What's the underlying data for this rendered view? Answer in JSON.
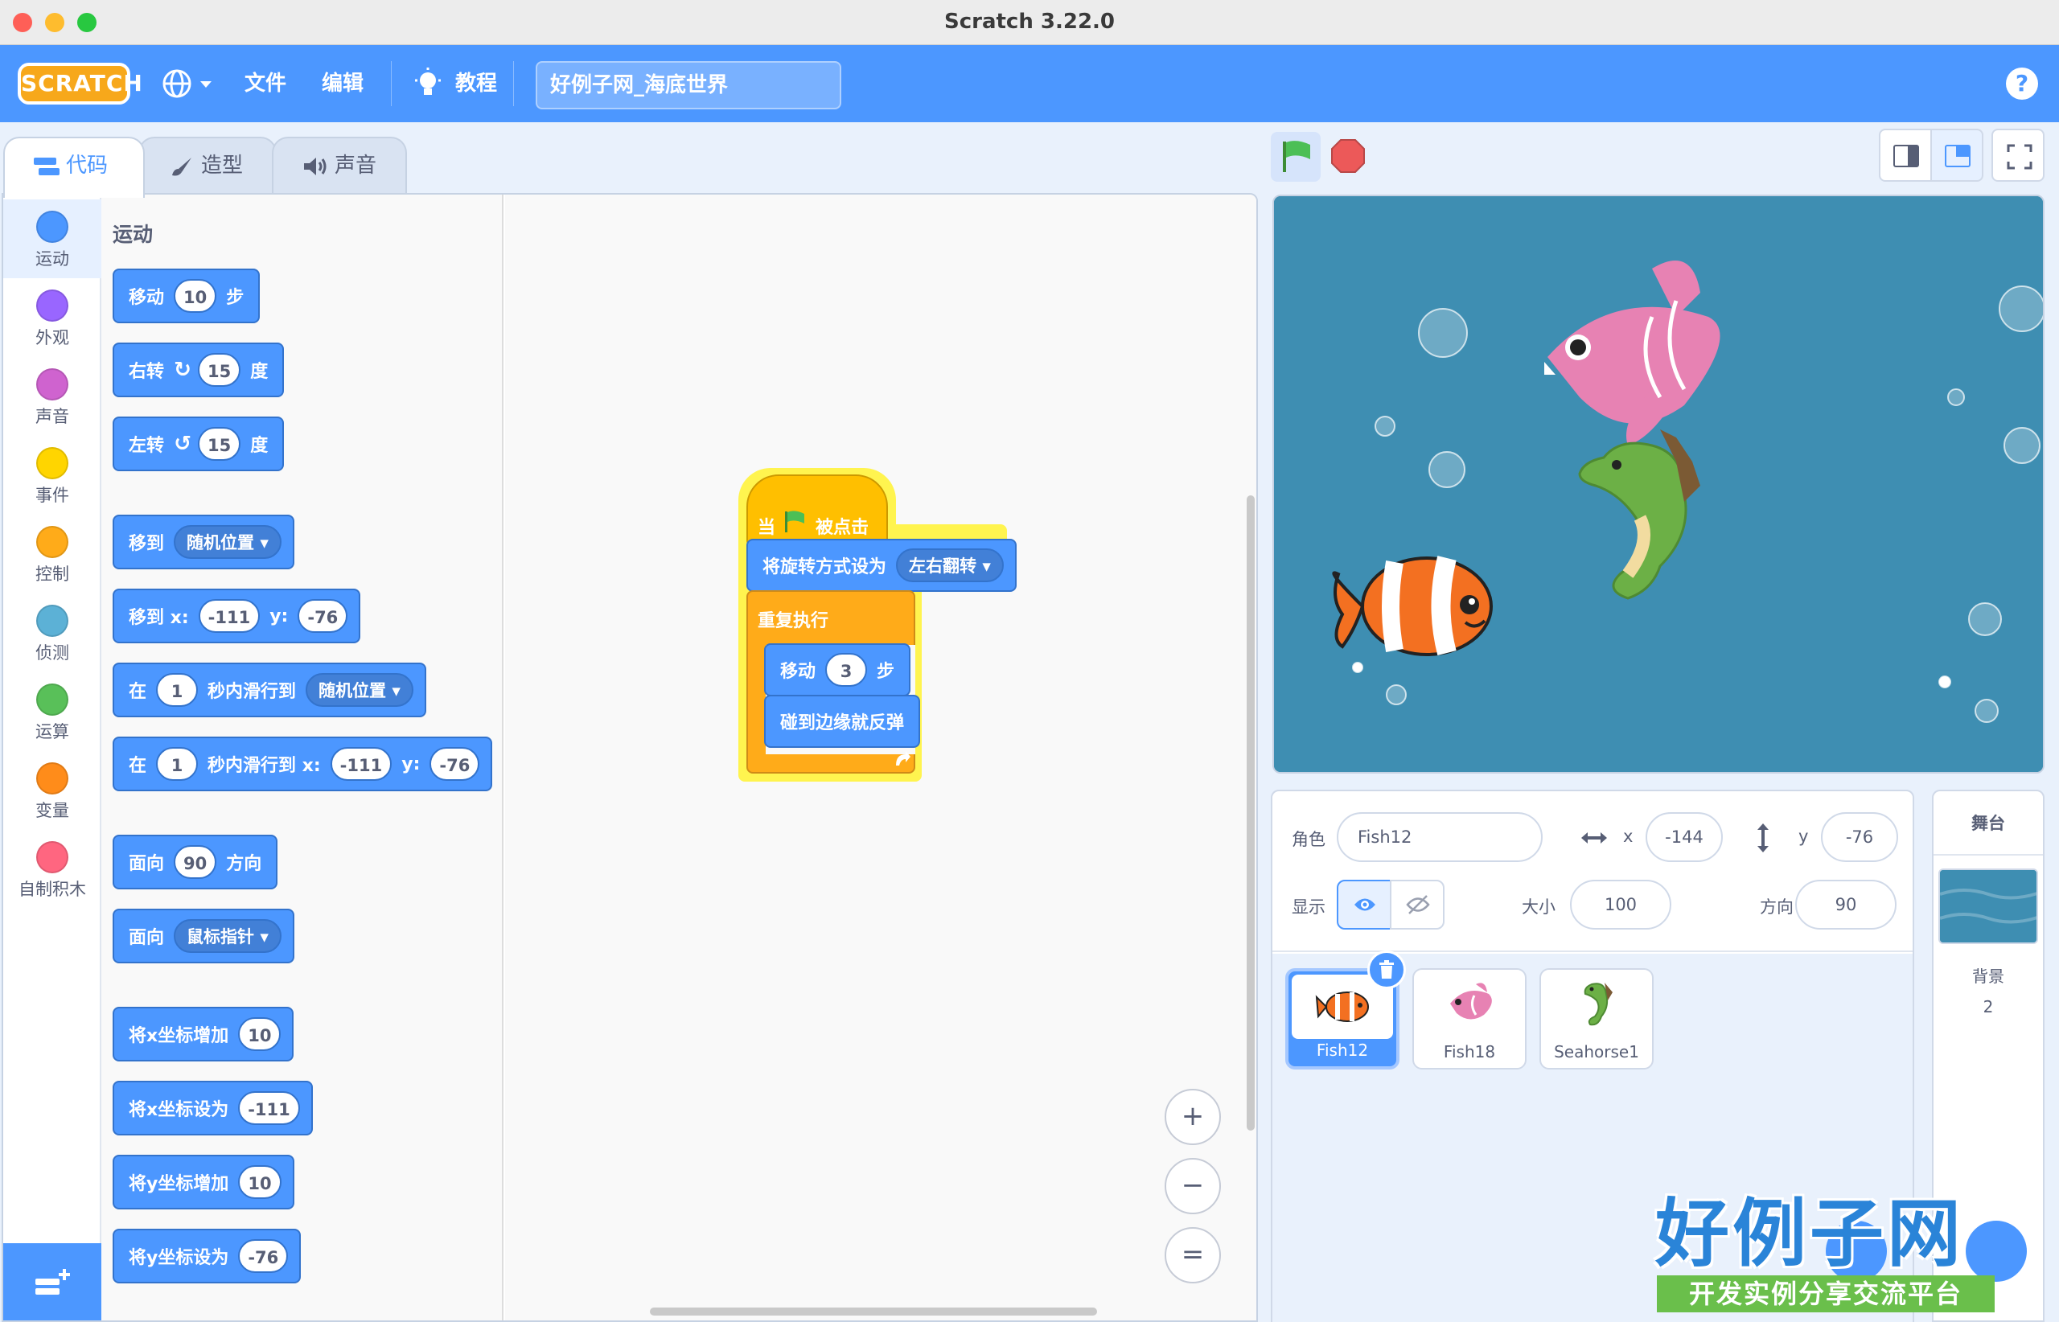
{
  "window": {
    "title": "Scratch 3.22.0"
  },
  "menubar": {
    "logo": "SCRATCH",
    "file": "文件",
    "edit": "编辑",
    "tutorials": "教程",
    "project_title": "好例子网_海底世界",
    "help": "?"
  },
  "tabs": [
    {
      "label": "代码",
      "active": true
    },
    {
      "label": "造型",
      "active": false
    },
    {
      "label": "声音",
      "active": false
    }
  ],
  "categories": [
    {
      "label": "运动",
      "color": "#4c97ff"
    },
    {
      "label": "外观",
      "color": "#9966ff"
    },
    {
      "label": "声音",
      "color": "#cf63cf"
    },
    {
      "label": "事件",
      "color": "#ffd500"
    },
    {
      "label": "控制",
      "color": "#ffab19"
    },
    {
      "label": "侦测",
      "color": "#5cb1d6"
    },
    {
      "label": "运算",
      "color": "#59c059"
    },
    {
      "label": "变量",
      "color": "#ff8c1a"
    },
    {
      "label": "自制积木",
      "color": "#ff6680"
    }
  ],
  "palette": {
    "section": "运动",
    "move": {
      "a": "移动",
      "v": "10",
      "b": "步"
    },
    "turn_right": {
      "a": "右转",
      "v": "15",
      "b": "度"
    },
    "turn_left": {
      "a": "左转",
      "v": "15",
      "b": "度"
    },
    "goto": {
      "a": "移到",
      "dd": "随机位置"
    },
    "goto_xy": {
      "a": "移到 x:",
      "x": "-111",
      "yl": "y:",
      "y": "-76"
    },
    "glide": {
      "a": "在",
      "v": "1",
      "b": "秒内滑行到",
      "dd": "随机位置"
    },
    "glide_xy": {
      "a": "在",
      "v": "1",
      "b": "秒内滑行到 x:",
      "x": "-111",
      "yl": "y:",
      "y": "-76"
    },
    "point_dir": {
      "a": "面向",
      "v": "90",
      "b": "方向"
    },
    "point_towards": {
      "a": "面向",
      "dd": "鼠标指针"
    },
    "change_x": {
      "a": "将x坐标增加",
      "v": "10"
    },
    "set_x": {
      "a": "将x坐标设为",
      "v": "-111"
    },
    "change_y": {
      "a": "将y坐标增加",
      "v": "10"
    },
    "set_y": {
      "a": "将y坐标设为",
      "v": "-76"
    }
  },
  "script": {
    "hat": {
      "a": "当",
      "b": "被点击"
    },
    "rotation": {
      "a": "将旋转方式设为",
      "dd": "左右翻转"
    },
    "forever": "重复执行",
    "move": {
      "a": "移动",
      "v": "3",
      "b": "步"
    },
    "bounce": "碰到边缘就反弹"
  },
  "zoom": {
    "in": "+",
    "out": "−",
    "reset": "="
  },
  "sprite_info": {
    "sprite_label": "角色",
    "sprite_name": "Fish12",
    "x_label": "x",
    "x": "-144",
    "y_label": "y",
    "y": "-76",
    "show_label": "显示",
    "size_label": "大小",
    "size": "100",
    "direction_label": "方向",
    "direction": "90"
  },
  "sprites": [
    {
      "name": "Fish12",
      "selected": true
    },
    {
      "name": "Fish18",
      "selected": false
    },
    {
      "name": "Seahorse1",
      "selected": false
    }
  ],
  "stage_panel": {
    "title": "舞台",
    "backdrop_label": "背景",
    "backdrop_count": "2"
  },
  "watermark": {
    "title": "好例子网",
    "subtitle": "开发实例分享交流平台"
  },
  "colors": {
    "motion": "#4c97ff",
    "events": "#ffbf00",
    "control": "#ffab19",
    "menubar": "#4c97ff"
  }
}
